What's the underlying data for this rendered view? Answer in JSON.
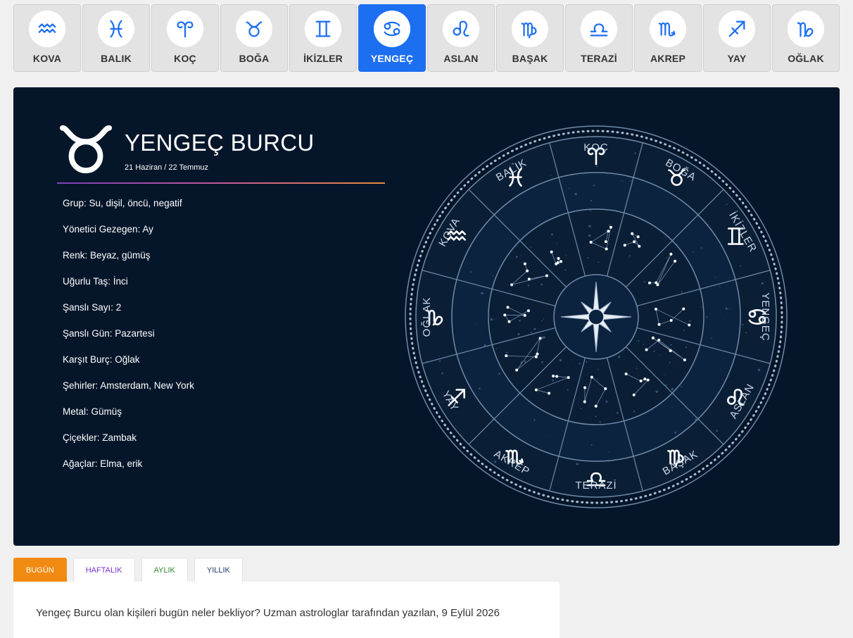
{
  "signs": [
    {
      "label": "KOVA",
      "icon": "aquarius-icon"
    },
    {
      "label": "BALIK",
      "icon": "pisces-icon"
    },
    {
      "label": "KOÇ",
      "icon": "aries-icon"
    },
    {
      "label": "BOĞA",
      "icon": "taurus-icon"
    },
    {
      "label": "İKİZLER",
      "icon": "gemini-icon"
    },
    {
      "label": "YENGEÇ",
      "icon": "cancer-icon",
      "active": true
    },
    {
      "label": "ASLAN",
      "icon": "leo-icon"
    },
    {
      "label": "BAŞAK",
      "icon": "virgo-icon"
    },
    {
      "label": "TERAZİ",
      "icon": "libra-icon"
    },
    {
      "label": "AKREP",
      "icon": "scorpio-icon"
    },
    {
      "label": "YAY",
      "icon": "sagittarius-icon"
    },
    {
      "label": "OĞLAK",
      "icon": "capricorn-icon"
    }
  ],
  "colors": {
    "active": "#1d6ff2",
    "icon": "#1d6ff2",
    "hero_bg": "#06162a",
    "tab_active": "#f08a10"
  },
  "hero": {
    "title": "YENGEÇ BURCU",
    "dates": "21 Haziran / 22 Temmuz",
    "symbol_icon": "taurus-icon",
    "facts": [
      "Grup: Su, dişil, öncü, negatif",
      "Yönetici Gezegen: Ay",
      "Renk: Beyaz, gümüş",
      "Uğurlu Taş: İnci",
      "Şanslı Sayı: 2",
      "Şanslı Gün: Pazartesi",
      "Karşıt Burç: Oğlak",
      "Şehirler: Amsterdam, New York",
      "Metal: Gümüş",
      "Çiçekler: Zambak",
      "Ağaçlar: Elma, erik"
    ],
    "wheel_labels": [
      "KOÇ",
      "BOĞA",
      "İKİZLER",
      "YENGEÇ",
      "ASLAN",
      "BAŞAK",
      "TERAZİ",
      "AKREP",
      "YAY",
      "OĞLAK",
      "KOVA",
      "BALIK"
    ]
  },
  "tabs": [
    {
      "label": "BUGÜN",
      "active": true
    },
    {
      "label": "HAFTALIK"
    },
    {
      "label": "AYLIK"
    },
    {
      "label": "YILLIK"
    }
  ],
  "content": {
    "text": "Yengeç Burcu olan kişileri bugün neler bekliyor? Uzman astrologlar tarafından yazılan, 9 Eylül 2026"
  }
}
